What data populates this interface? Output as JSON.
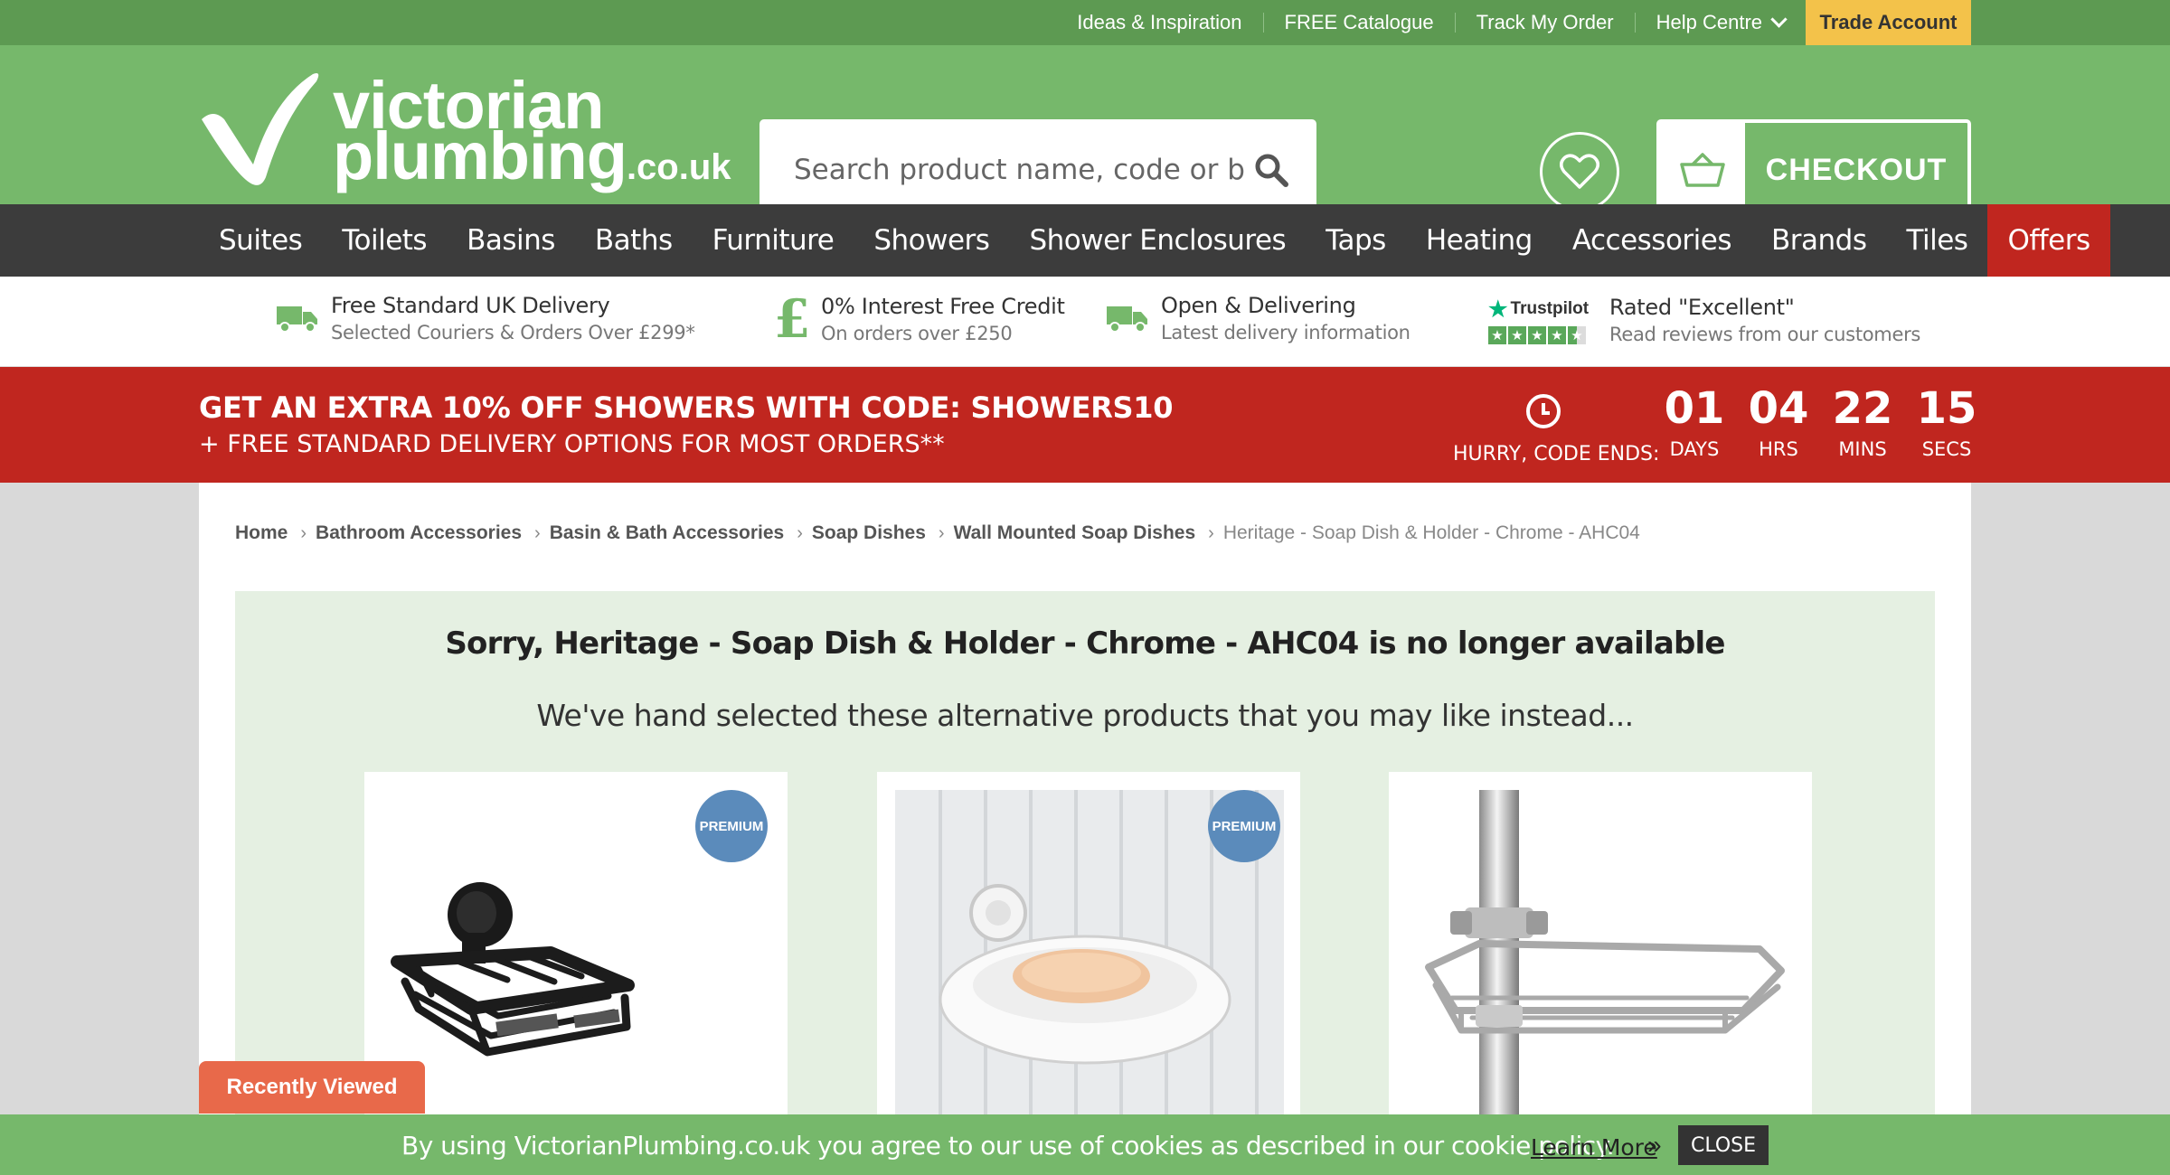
{
  "topbar": {
    "links": [
      "Ideas & Inspiration",
      "FREE Catalogue",
      "Track My Order"
    ],
    "help_label": "Help Centre",
    "trade_label": "Trade Account"
  },
  "header": {
    "logo_line1": "victorian",
    "logo_line2": "plumbing",
    "logo_tld": ".co.uk",
    "search_placeholder": "Search product name, code or brand",
    "checkout_label": "CHECKOUT"
  },
  "nav": {
    "items": [
      "Suites",
      "Toilets",
      "Basins",
      "Baths",
      "Furniture",
      "Showers",
      "Shower Enclosures",
      "Taps",
      "Heating",
      "Accessories",
      "Brands",
      "Tiles",
      "Offers"
    ]
  },
  "usps": [
    {
      "title": "Free Standard UK Delivery",
      "subtitle": "Selected Couriers & Orders Over £299*",
      "icon": "truck-icon"
    },
    {
      "title": "0% Interest Free Credit",
      "subtitle": "On orders over £250",
      "icon": "pound-icon"
    },
    {
      "title": "Open & Delivering",
      "subtitle": "Latest delivery information",
      "icon": "truck-icon"
    },
    {
      "title": "Rated \"Excellent\"",
      "subtitle": "Read reviews from our customers",
      "icon": "trustpilot-icon",
      "brand": "Trustpilot"
    }
  ],
  "promo": {
    "headline": "GET AN EXTRA 10% OFF SHOWERS WITH CODE: SHOWERS10",
    "subline": "+ FREE STANDARD DELIVERY OPTIONS FOR MOST ORDERS**",
    "hurry": "HURRY, CODE ENDS:",
    "countdown": [
      {
        "value": "01",
        "unit": "DAYS"
      },
      {
        "value": "04",
        "unit": "HRS"
      },
      {
        "value": "22",
        "unit": "MINS"
      },
      {
        "value": "15",
        "unit": "SECS"
      }
    ]
  },
  "breadcrumb": [
    "Home",
    "Bathroom Accessories",
    "Basin & Bath Accessories",
    "Soap Dishes",
    "Wall Mounted Soap Dishes",
    "Heritage - Soap Dish & Holder - Chrome - AHC04"
  ],
  "alternatives": {
    "title": "Sorry, Heritage - Soap Dish & Holder - Chrome - AHC04 is no longer available",
    "subtitle": "We've hand selected these alternative products that you may like instead...",
    "products": [
      {
        "image": "black-wire-soap-basket",
        "badge": "PREMIUM"
      },
      {
        "image": "white-ceramic-soap-dish",
        "badge": "PREMIUM"
      },
      {
        "image": "chrome-riser-rail-soap-basket",
        "badge": ""
      }
    ]
  },
  "recently_viewed": "Recently Viewed",
  "cookie": {
    "message": "By using VictorianPlumbing.co.uk you agree to our use of cookies as described in our cookie policy.",
    "learn_more": "Learn More",
    "close": "CLOSE"
  },
  "colors": {
    "brand_green": "#76b86b",
    "dark_green": "#5d9a52",
    "nav": "#3c3c3c",
    "offer_red": "#c0261f",
    "trade_yellow": "#f3c24a",
    "premium_blue": "#5b8bbb",
    "recent_orange": "#e8694a"
  }
}
